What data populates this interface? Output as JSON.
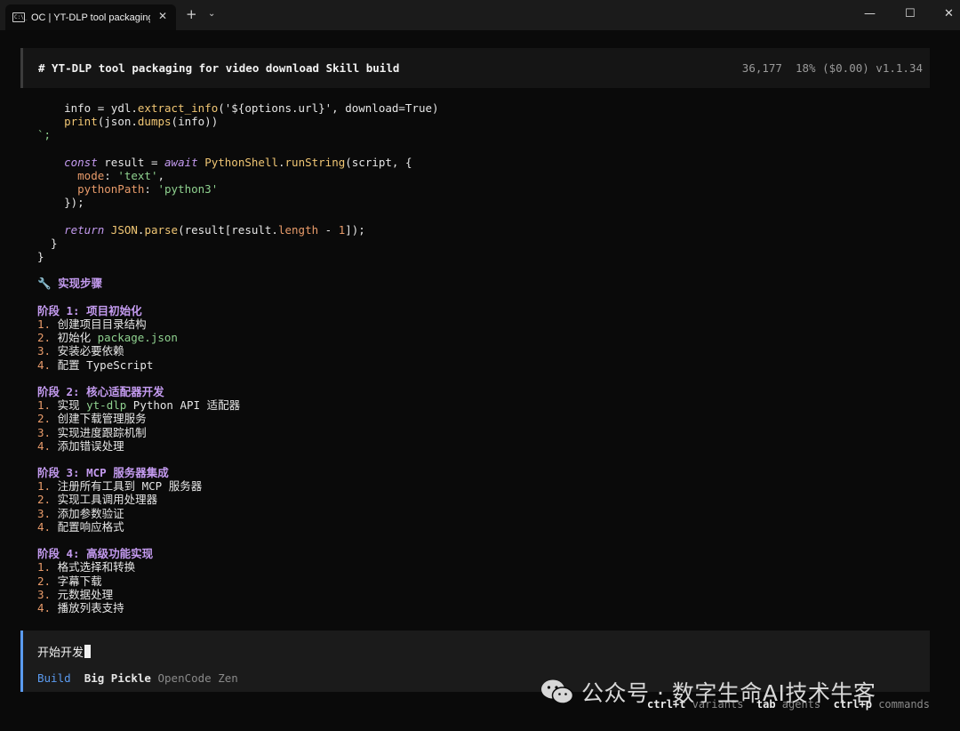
{
  "window": {
    "tab_title": "OC | YT-DLP tool packaging fo",
    "tab_icon_text": "C:\\_",
    "new_tab": "+",
    "dropdown": "⌄",
    "close_tab": "✕",
    "minimize": "—",
    "maximize": "☐",
    "close": "✕"
  },
  "header": {
    "title": "# YT-DLP tool packaging for video download Skill build",
    "stats": "36,177  18% ($0.00) v1.1.34"
  },
  "code": {
    "l1_indent": "    ",
    "l1_a": "info = ydl.",
    "l1_fn": "extract_info",
    "l1_b": "('${options.url}', download=True)",
    "l2_indent": "    ",
    "l2_fn": "print",
    "l2_b": "(json.",
    "l2_fn2": "dumps",
    "l2_c": "(info))",
    "l3": "`;",
    "l4_indent": "    ",
    "l4_kw": "const",
    "l4_var": " result = ",
    "l4_kw2": "await",
    "l4_sp": " ",
    "l4_obj": "PythonShell",
    "l4_dot": ".",
    "l4_fn": "runString",
    "l4_rest": "(script, {",
    "l5_indent": "      ",
    "l5_prop": "mode",
    "l5_colon": ": ",
    "l5_str": "'text'",
    "l5_comma": ",",
    "l6_indent": "      ",
    "l6_prop": "pythonPath",
    "l6_colon": ": ",
    "l6_str": "'python3'",
    "l7": "    });",
    "l8_indent": "    ",
    "l8_kw": "return",
    "l8_sp": " ",
    "l8_obj": "JSON",
    "l8_dot": ".",
    "l8_fn": "parse",
    "l8_a": "(result[result.",
    "l8_prop": "length",
    "l8_b": " - ",
    "l8_num": "1",
    "l8_c": "]);",
    "l9": "  }",
    "l10": "}"
  },
  "plan": {
    "heading": "🔧 实现步骤",
    "stages": [
      {
        "title": "阶段 1: 项目初始化",
        "items": [
          {
            "num": "1.",
            "text": "创建项目目录结构",
            "code": "",
            "after": ""
          },
          {
            "num": "2.",
            "text": "初始化 ",
            "code": "package.json",
            "after": ""
          },
          {
            "num": "3.",
            "text": "安装必要依赖",
            "code": "",
            "after": ""
          },
          {
            "num": "4.",
            "text": "配置 TypeScript",
            "code": "",
            "after": ""
          }
        ]
      },
      {
        "title": "阶段 2: 核心适配器开发",
        "items": [
          {
            "num": "1.",
            "text": "实现 ",
            "code": "yt-dlp",
            "after": " Python API 适配器"
          },
          {
            "num": "2.",
            "text": "创建下载管理服务",
            "code": "",
            "after": ""
          },
          {
            "num": "3.",
            "text": "实现进度跟踪机制",
            "code": "",
            "after": ""
          },
          {
            "num": "4.",
            "text": "添加错误处理",
            "code": "",
            "after": ""
          }
        ]
      },
      {
        "title": "阶段 3: MCP 服务器集成",
        "items": [
          {
            "num": "1.",
            "text": "注册所有工具到 MCP 服务器",
            "code": "",
            "after": ""
          },
          {
            "num": "2.",
            "text": "实现工具调用处理器",
            "code": "",
            "after": ""
          },
          {
            "num": "3.",
            "text": "添加参数验证",
            "code": "",
            "after": ""
          },
          {
            "num": "4.",
            "text": "配置响应格式",
            "code": "",
            "after": ""
          }
        ]
      },
      {
        "title": "阶段 4: 高级功能实现",
        "items": [
          {
            "num": "1.",
            "text": "格式选择和转换",
            "code": "",
            "after": ""
          },
          {
            "num": "2.",
            "text": "字幕下载",
            "code": "",
            "after": ""
          },
          {
            "num": "3.",
            "text": "元数据处理",
            "code": "",
            "after": ""
          },
          {
            "num": "4.",
            "text": "播放列表支持",
            "code": "",
            "after": ""
          }
        ]
      }
    ]
  },
  "input": {
    "value": "开始开发",
    "mode": "Build",
    "model": "Big Pickle",
    "provider": "OpenCode Zen"
  },
  "shortcuts": [
    {
      "key": "ctrl+t",
      "desc": "variants"
    },
    {
      "key": "tab",
      "desc": "agents"
    },
    {
      "key": "ctrl+p",
      "desc": "commands"
    }
  ],
  "watermark": {
    "text": "公众号 · 数字生命AI技术牛客",
    "icon": "wechat-icon"
  },
  "colors": {
    "background": "#0a0a0a",
    "accent": "#5b9bf0",
    "heading": "#c49bf0",
    "string": "#8fd18f",
    "function": "#f0c674",
    "number": "#e89b6a"
  }
}
